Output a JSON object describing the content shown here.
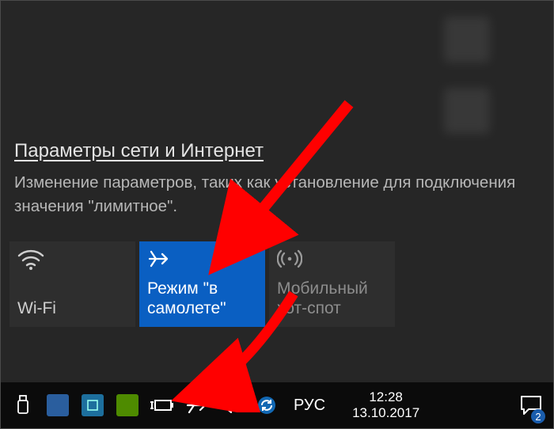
{
  "settings": {
    "title": "Параметры сети и Интернет",
    "description": "Изменение параметров, таких как установление для подключения значения \"лимитное\"."
  },
  "tiles": {
    "wifi": {
      "label": "Wi-Fi"
    },
    "airplane": {
      "label": "Режим \"в самолете\""
    },
    "hotspot": {
      "label": "Мобильный хот-спот"
    }
  },
  "taskbar": {
    "language": "РУС",
    "time": "12:28",
    "date": "13.10.2017",
    "notifications": "2"
  }
}
